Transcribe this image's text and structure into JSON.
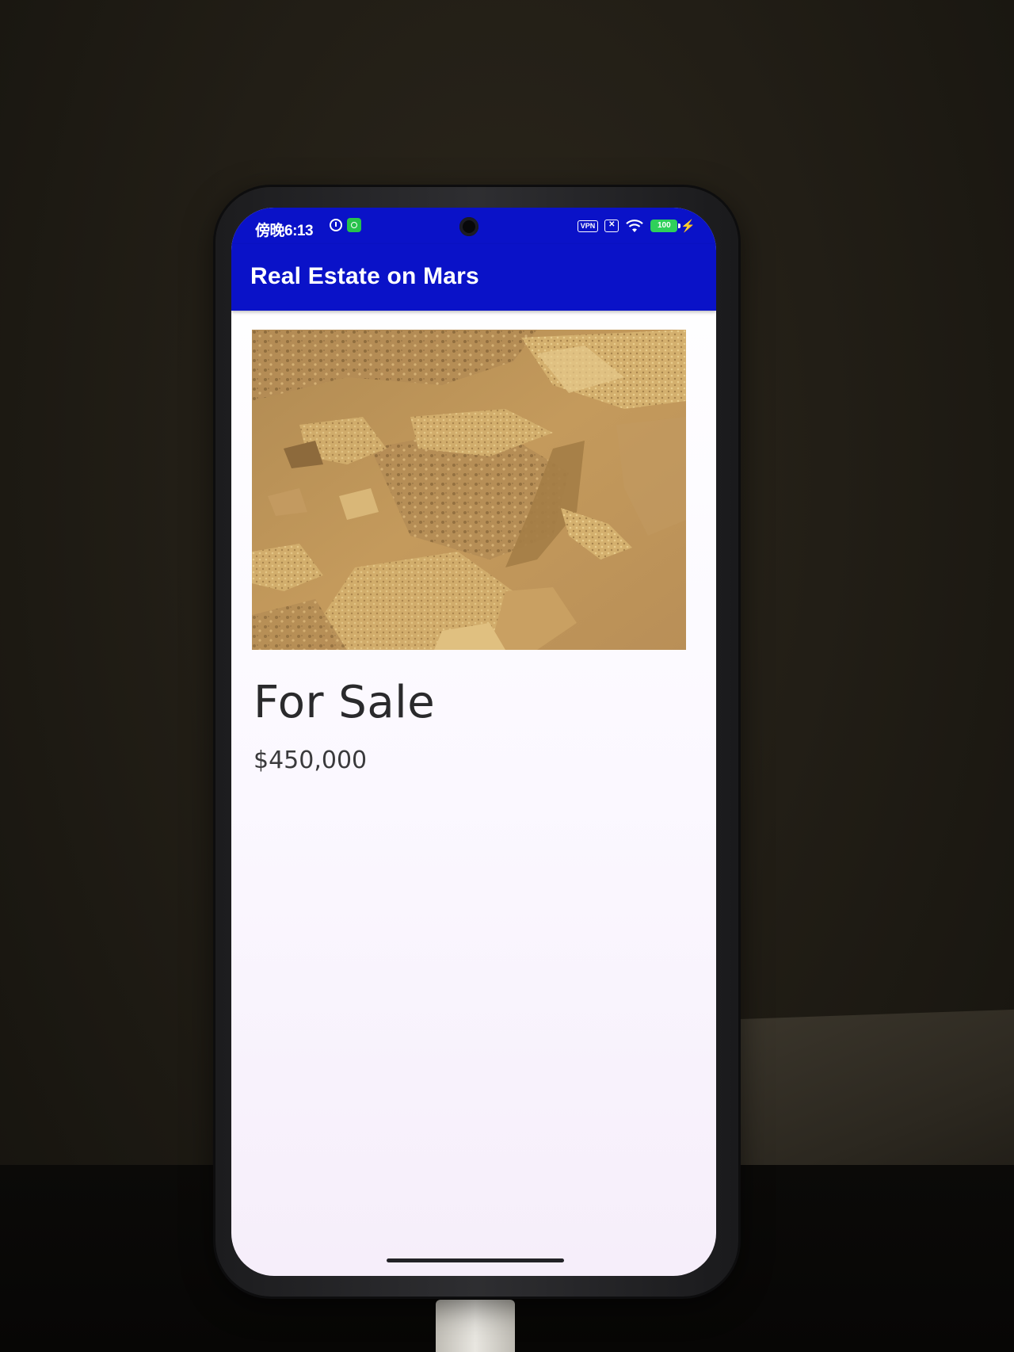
{
  "status_bar": {
    "time": "傍晚6:13",
    "alarm_icon": "alarm-clock-icon",
    "notification_icon": "wechat-icon",
    "vpn_label": "VPN",
    "sim_label": "✕",
    "wifi_icon": "wifi-icon",
    "battery_level": "100",
    "charging_icon": "lightning-bolt-icon"
  },
  "app_bar": {
    "title": "Real Estate on Mars",
    "color": "#0a12c8"
  },
  "property": {
    "image_description_icon": "mars-terrain-photo",
    "status": "For Sale",
    "price": "$450,000"
  },
  "colors": {
    "app_bar": "#0a12c8",
    "background": "#ffffff",
    "text_primary": "#2a2a2c",
    "battery": "#2fd05a"
  }
}
